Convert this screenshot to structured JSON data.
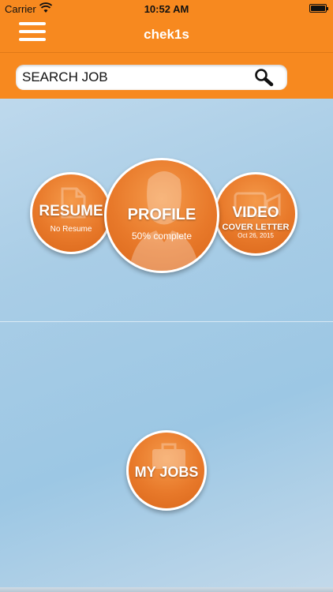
{
  "status_bar": {
    "carrier": "Carrier",
    "time": "10:52 AM"
  },
  "nav": {
    "title": "chek1s"
  },
  "search": {
    "placeholder": "SEARCH JOB"
  },
  "circles": {
    "resume": {
      "label": "RESUME",
      "status": "No Resume"
    },
    "profile": {
      "label": "PROFILE",
      "status": "50% complete"
    },
    "video": {
      "label": "VIDEO",
      "sublabel": "COVER LETTER",
      "date": "Oct 26, 2015"
    },
    "myjobs": {
      "label": "MY JOBS"
    }
  },
  "colors": {
    "accent": "#f7891f",
    "circle": "#e8792a",
    "background": "#a9cde6"
  },
  "icons": {
    "menu": "hamburger-menu-icon",
    "search": "magnifier-icon",
    "resume": "document-icon",
    "profile": "person-silhouette-icon",
    "video": "video-camera-icon",
    "myjobs": "briefcase-icon"
  }
}
